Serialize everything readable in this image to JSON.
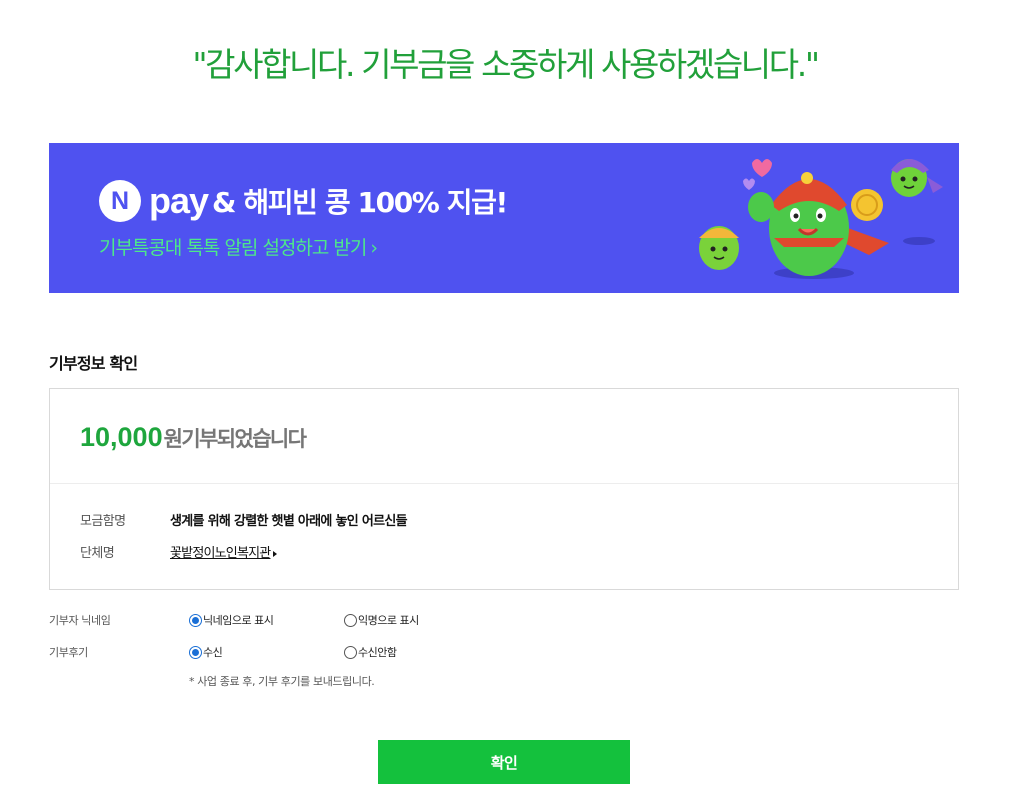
{
  "headline": "\"감사합니다. 기부금을 소중하게 사용하겠습니다.\"",
  "banner": {
    "npay_letter": "N",
    "npay_word": "pay",
    "title": "& 해피빈 콩 100% 지급!",
    "subtitle": "기부특콩대 톡톡 알림 설정하고 받기",
    "chevron": "›",
    "bg_color": "#4f52f0",
    "sub_color": "#4de88a"
  },
  "section_title": "기부정보 확인",
  "donation": {
    "amount": "10,000",
    "amount_suffix": "원기부되었습니다",
    "campaign_label": "모금함명",
    "campaign_value": "생계를 위해 강렬한 햇볕 아래에 놓인 어르신들",
    "org_label": "단체명",
    "org_value": "꽃밭정이노인복지관"
  },
  "options": {
    "nickname": {
      "label": "기부자 닉네임",
      "choices": [
        "닉네임으로 표시",
        "익명으로 표시"
      ],
      "selected": 0
    },
    "review": {
      "label": "기부후기",
      "choices": [
        "수신",
        "수신안함"
      ],
      "selected": 0
    },
    "note": "* 사업 종료 후, 기부 후기를 보내드립니다."
  },
  "confirm_label": "확인",
  "colors": {
    "accent_green": "#21a03a",
    "amount_green": "#1ea63d",
    "button_green": "#14c13d",
    "radio_blue": "#1a6fd6"
  }
}
